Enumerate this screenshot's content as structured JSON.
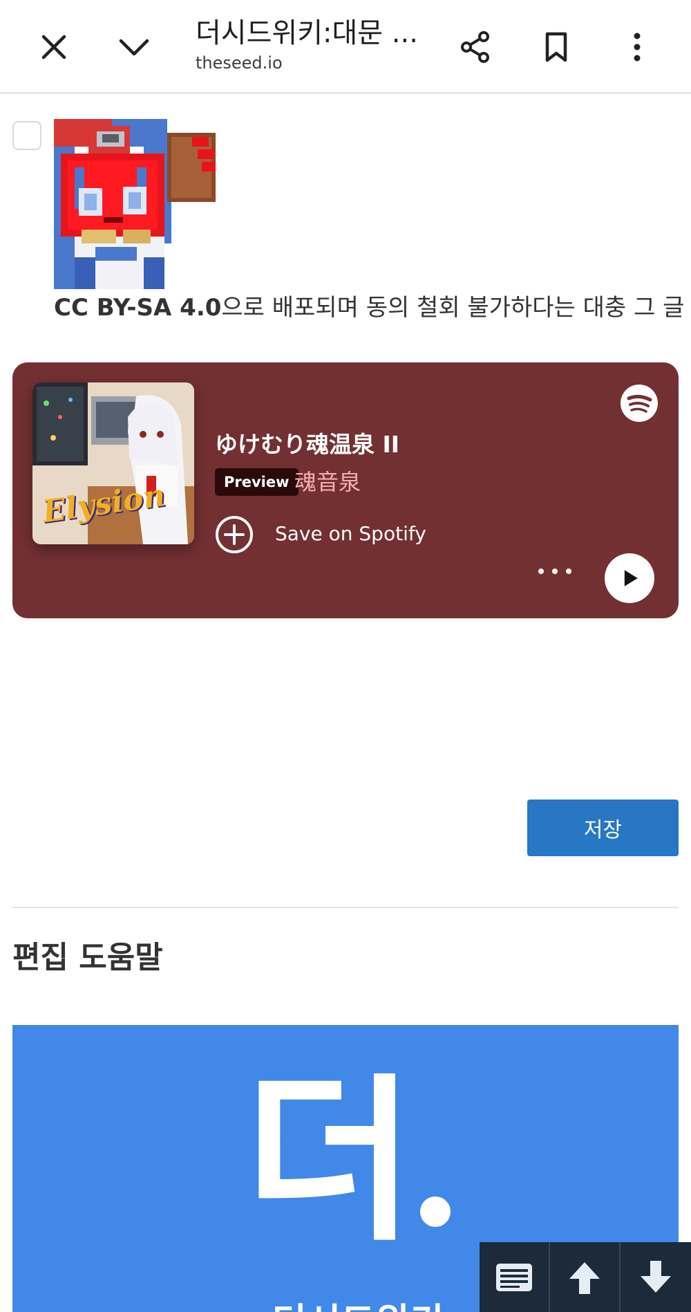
{
  "browser": {
    "page_title": "더시드위키:대문 ...",
    "domain": "theseed.io",
    "icons": [
      "close-icon",
      "chevron-down-icon",
      "share-icon",
      "bookmark-icon",
      "more-vert-icon"
    ]
  },
  "content": {
    "license_bold": "CC BY-SA 4.0",
    "license_rest": "으로 배포되며 동의 철회 불가하다는 대충 그 글"
  },
  "spotify": {
    "track_title": "ゆけむり魂温泉 II",
    "preview_label": "Preview",
    "artist": "魂音泉",
    "save_label": "Save on Spotify",
    "album_caption": "Elysion",
    "colors": {
      "background": "#733033",
      "artist": "#f5b0b0"
    }
  },
  "form": {
    "save_button_label": "저장"
  },
  "help": {
    "heading": "편집 도움말",
    "banner_glyph": "더",
    "banner_subtitle": "더시드위키",
    "banner_color": "#4288e8"
  },
  "floating_toolbar": {
    "icons": [
      "toc-icon",
      "arrow-up-icon",
      "arrow-down-icon"
    ]
  }
}
